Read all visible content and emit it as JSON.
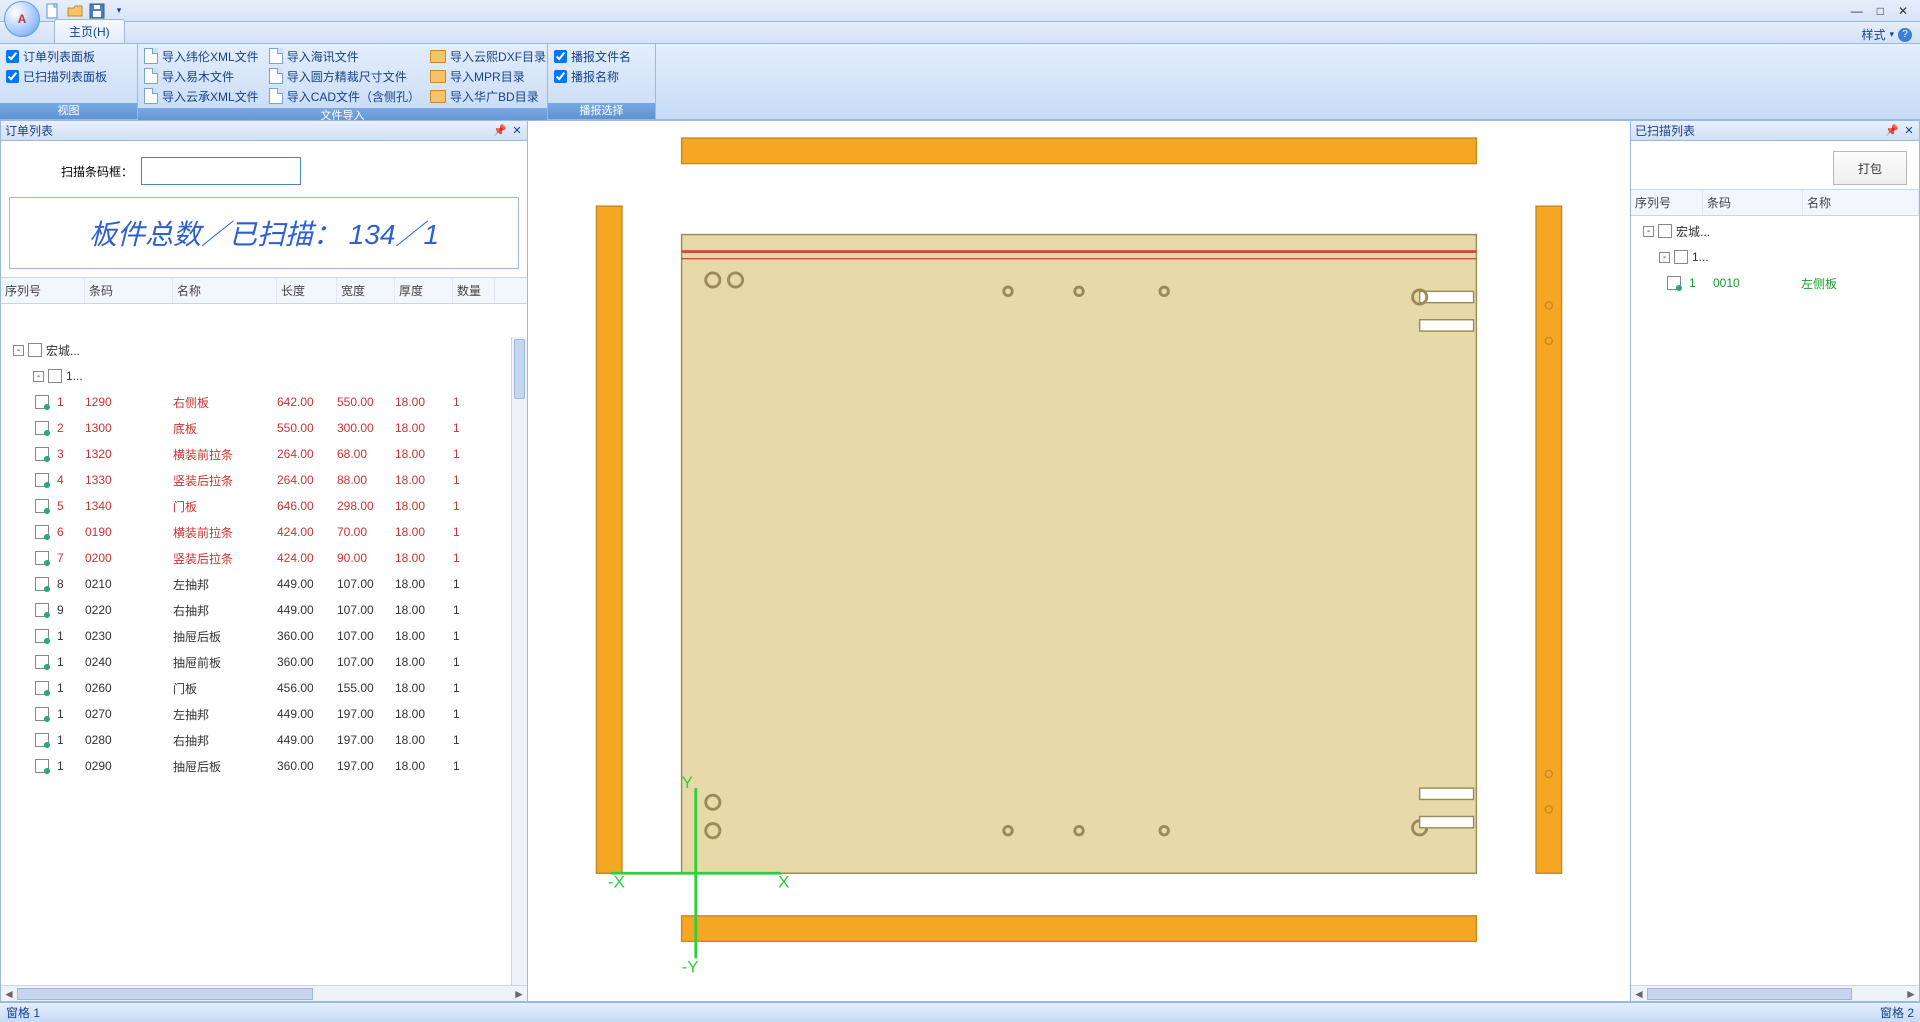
{
  "qat": {
    "new_tip": "new",
    "open_tip": "open",
    "save_tip": "save"
  },
  "tabs": {
    "home": "主页(H)"
  },
  "style_menu": "样式",
  "ribbon": {
    "view": {
      "label": "视图",
      "order_panel_chk": "订单列表面板",
      "scanned_panel_chk": "已扫描列表面板"
    },
    "import": {
      "label": "文件导入",
      "c1r1": "导入纬伦XML文件",
      "c1r2": "导入易木文件",
      "c1r3": "导入云承XML文件",
      "c2r1": "导入海讯文件",
      "c2r2": "导入圆方精裁尺寸文件",
      "c2r3": "导入CAD文件（含侧孔）",
      "c3r1": "导入云熙DXF目录",
      "c3r2": "导入MPR目录",
      "c3r3": "导入华广BD目录"
    },
    "broadcast": {
      "label": "播报选择",
      "file": "播报文件名",
      "name": "播报名称"
    }
  },
  "left": {
    "title": "订单列表",
    "scan_label": "扫描条码框：",
    "big": "板件总数／已扫描：  134／1",
    "cols": {
      "idx": "序列号",
      "bc": "条码",
      "nm": "名称",
      "len": "长度",
      "w": "宽度",
      "t": "厚度",
      "q": "数量"
    },
    "root": "宏城...",
    "sub": "1...",
    "rows": [
      {
        "i": "1",
        "bc": "1290",
        "nm": "右侧板",
        "l": "642.00",
        "w": "550.00",
        "t": "18.00",
        "q": "1",
        "red": true
      },
      {
        "i": "2",
        "bc": "1300",
        "nm": "底板",
        "l": "550.00",
        "w": "300.00",
        "t": "18.00",
        "q": "1",
        "red": true
      },
      {
        "i": "3",
        "bc": "1320",
        "nm": "横装前拉条",
        "l": "264.00",
        "w": "68.00",
        "t": "18.00",
        "q": "1",
        "red": true
      },
      {
        "i": "4",
        "bc": "1330",
        "nm": "竖装后拉条",
        "l": "264.00",
        "w": "88.00",
        "t": "18.00",
        "q": "1",
        "red": true
      },
      {
        "i": "5",
        "bc": "1340",
        "nm": "门板",
        "l": "646.00",
        "w": "298.00",
        "t": "18.00",
        "q": "1",
        "red": true
      },
      {
        "i": "6",
        "bc": "0190",
        "nm": "横装前拉条",
        "l": "424.00",
        "w": "70.00",
        "t": "18.00",
        "q": "1",
        "red": true
      },
      {
        "i": "7",
        "bc": "0200",
        "nm": "竖装后拉条",
        "l": "424.00",
        "w": "90.00",
        "t": "18.00",
        "q": "1",
        "red": true
      },
      {
        "i": "8",
        "bc": "0210",
        "nm": "左抽邦",
        "l": "449.00",
        "w": "107.00",
        "t": "18.00",
        "q": "1",
        "red": false
      },
      {
        "i": "9",
        "bc": "0220",
        "nm": "右抽邦",
        "l": "449.00",
        "w": "107.00",
        "t": "18.00",
        "q": "1",
        "red": false
      },
      {
        "i": "1",
        "bc": "0230",
        "nm": "抽屉后板",
        "l": "360.00",
        "w": "107.00",
        "t": "18.00",
        "q": "1",
        "red": false
      },
      {
        "i": "1",
        "bc": "0240",
        "nm": "抽屉前板",
        "l": "360.00",
        "w": "107.00",
        "t": "18.00",
        "q": "1",
        "red": false
      },
      {
        "i": "1",
        "bc": "0260",
        "nm": "门板",
        "l": "456.00",
        "w": "155.00",
        "t": "18.00",
        "q": "1",
        "red": false
      },
      {
        "i": "1",
        "bc": "0270",
        "nm": "左抽邦",
        "l": "449.00",
        "w": "197.00",
        "t": "18.00",
        "q": "1",
        "red": false
      },
      {
        "i": "1",
        "bc": "0280",
        "nm": "右抽邦",
        "l": "449.00",
        "w": "197.00",
        "t": "18.00",
        "q": "1",
        "red": false
      },
      {
        "i": "1",
        "bc": "0290",
        "nm": "抽屉后板",
        "l": "360.00",
        "w": "197.00",
        "t": "18.00",
        "q": "1",
        "red": false
      }
    ]
  },
  "right": {
    "title": "已扫描列表",
    "pack_btn": "打包",
    "cols": {
      "idx": "序列号",
      "bc": "条码",
      "nm": "名称"
    },
    "root": "宏城...",
    "sub": "1...",
    "rows": [
      {
        "i": "1",
        "bc": "0010",
        "nm": "左侧板"
      }
    ]
  },
  "footer": {
    "left": "窗格 1",
    "right": "窗格 2"
  },
  "colors": {
    "panel_orange": "#f5a623",
    "panel_fill": "#e8d9a8",
    "axis_green": "#2bd13a",
    "edge_red": "#d24a3a"
  }
}
